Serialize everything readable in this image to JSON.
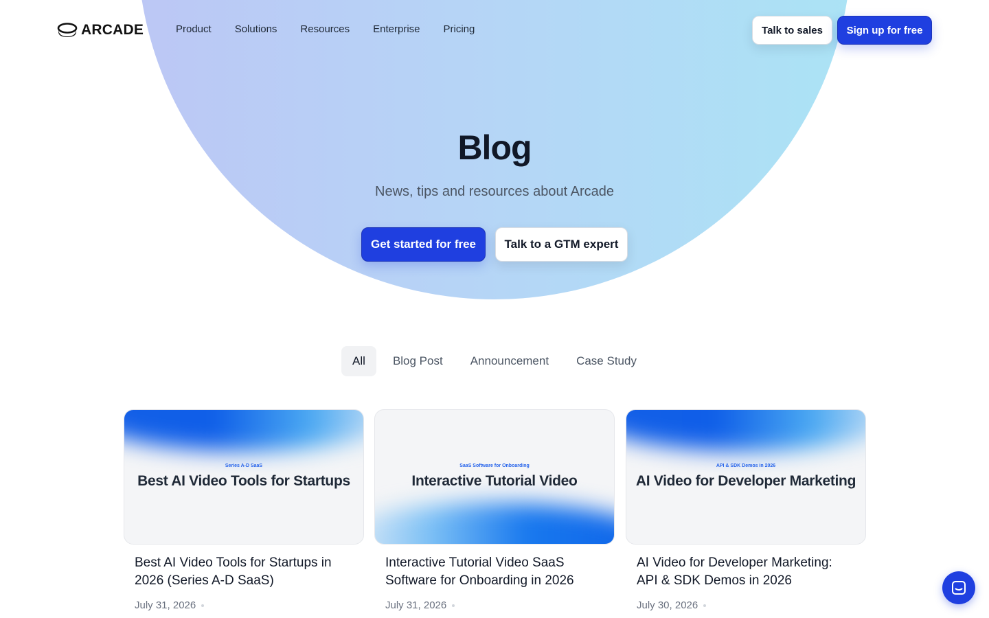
{
  "brand": {
    "name": "ARCADE"
  },
  "nav": {
    "links": [
      "Product",
      "Solutions",
      "Resources",
      "Enterprise",
      "Pricing"
    ],
    "talk_to_sales": "Talk to sales",
    "sign_up": "Sign up for free"
  },
  "hero": {
    "title": "Blog",
    "subtitle": "News, tips and resources about Arcade",
    "primary_cta": "Get started for free",
    "secondary_cta": "Talk to a GTM expert"
  },
  "filters": {
    "tabs": [
      "All",
      "Blog Post",
      "Announcement",
      "Case Study"
    ],
    "active": "All"
  },
  "posts": [
    {
      "thumb_kicker": "Series A-D SaaS",
      "thumb_title": "Best AI Video Tools for Startups",
      "title": "Best AI Video Tools for Startups in 2026 (Series A-D SaaS)",
      "date": "July 31, 2026"
    },
    {
      "thumb_kicker": "SaaS Software for Onboarding",
      "thumb_title": "Interactive Tutorial Video",
      "title": "Interactive Tutorial Video SaaS Software for Onboarding in 2026",
      "date": "July 31, 2026"
    },
    {
      "thumb_kicker": "API & SDK Demos in 2026",
      "thumb_title": "AI Video for Developer Marketing",
      "title": "AI Video for Developer Marketing: API & SDK Demos in 2026",
      "date": "July 30, 2026"
    }
  ],
  "colors": {
    "accent": "#1f3fe0",
    "hero_gradient_start": "#bcc7f5",
    "hero_gradient_end": "#abe3f5"
  },
  "icons": {
    "logo": "arcade-logo-icon",
    "chat": "chat-bubble-icon"
  }
}
